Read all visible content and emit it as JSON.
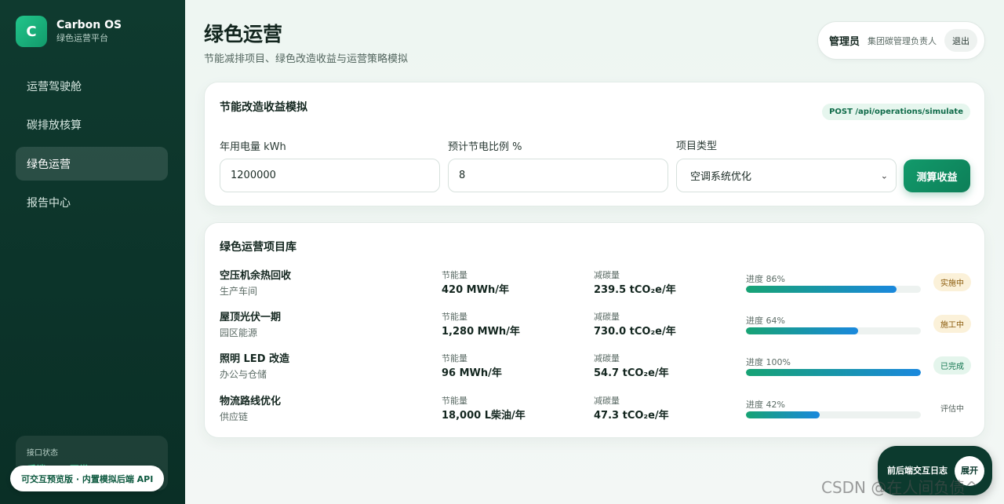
{
  "brand": {
    "logo_letter": "C",
    "name": "Carbon OS",
    "subtitle": "绿色运营平台"
  },
  "sidebar": {
    "items": [
      {
        "label": "运营驾驶舱",
        "active": false
      },
      {
        "label": "碳排放核算",
        "active": false
      },
      {
        "label": "绿色运营",
        "active": true
      },
      {
        "label": "报告中心",
        "active": false
      }
    ],
    "api_status_label": "接口状态",
    "api_status_value": "后端 API 正常",
    "preview_pill": "可交互预览版 · 内置模拟后端 API"
  },
  "header": {
    "title": "绿色运营",
    "subtitle": "节能减排项目、绿色改造收益与运营策略模拟",
    "user_role": "管理员",
    "user_name": "集团碳管理负责人",
    "logout_label": "退出"
  },
  "simulation": {
    "title": "节能改造收益模拟",
    "endpoint": "POST /api/operations/simulate",
    "fields": {
      "electricity_label": "年用电量 kWh",
      "electricity_value": "1200000",
      "saving_label": "预计节电比例 %",
      "saving_value": "8",
      "type_label": "项目类型",
      "type_value": "空调系统优化"
    },
    "submit_label": "测算收益"
  },
  "library": {
    "title": "绿色运营项目库",
    "energy_label": "节能量",
    "carbon_label": "减碳量",
    "progress_prefix": "进度",
    "projects": [
      {
        "name": "空压机余热回收",
        "category": "生产车间",
        "energy": "420 MWh/年",
        "carbon": "239.5 tCO₂e/年",
        "progress": 86,
        "progress_text": "进度 86%",
        "status": "实施中",
        "status_type": "amber"
      },
      {
        "name": "屋顶光伏一期",
        "category": "园区能源",
        "energy": "1,280 MWh/年",
        "carbon": "730.0 tCO₂e/年",
        "progress": 64,
        "progress_text": "进度 64%",
        "status": "施工中",
        "status_type": "amber"
      },
      {
        "name": "照明 LED 改造",
        "category": "办公与仓储",
        "energy": "96 MWh/年",
        "carbon": "54.7 tCO₂e/年",
        "progress": 100,
        "progress_text": "进度 100%",
        "status": "已完成",
        "status_type": "green"
      },
      {
        "name": "物流路线优化",
        "category": "供应链",
        "energy": "18,000 L柴油/年",
        "carbon": "47.3 tCO₂e/年",
        "progress": 42,
        "progress_text": "进度 42%",
        "status": "评估中",
        "status_type": "gray"
      }
    ]
  },
  "log_panel": {
    "label": "前后端交互日志",
    "toggle_label": "展开"
  },
  "watermark": "CSDN @在人间负债^",
  "colors": {
    "sidebar_bg": "#0f3a2f",
    "accent": "#129a6b",
    "progress_start": "#17a374",
    "progress_end": "#1a88dd"
  }
}
